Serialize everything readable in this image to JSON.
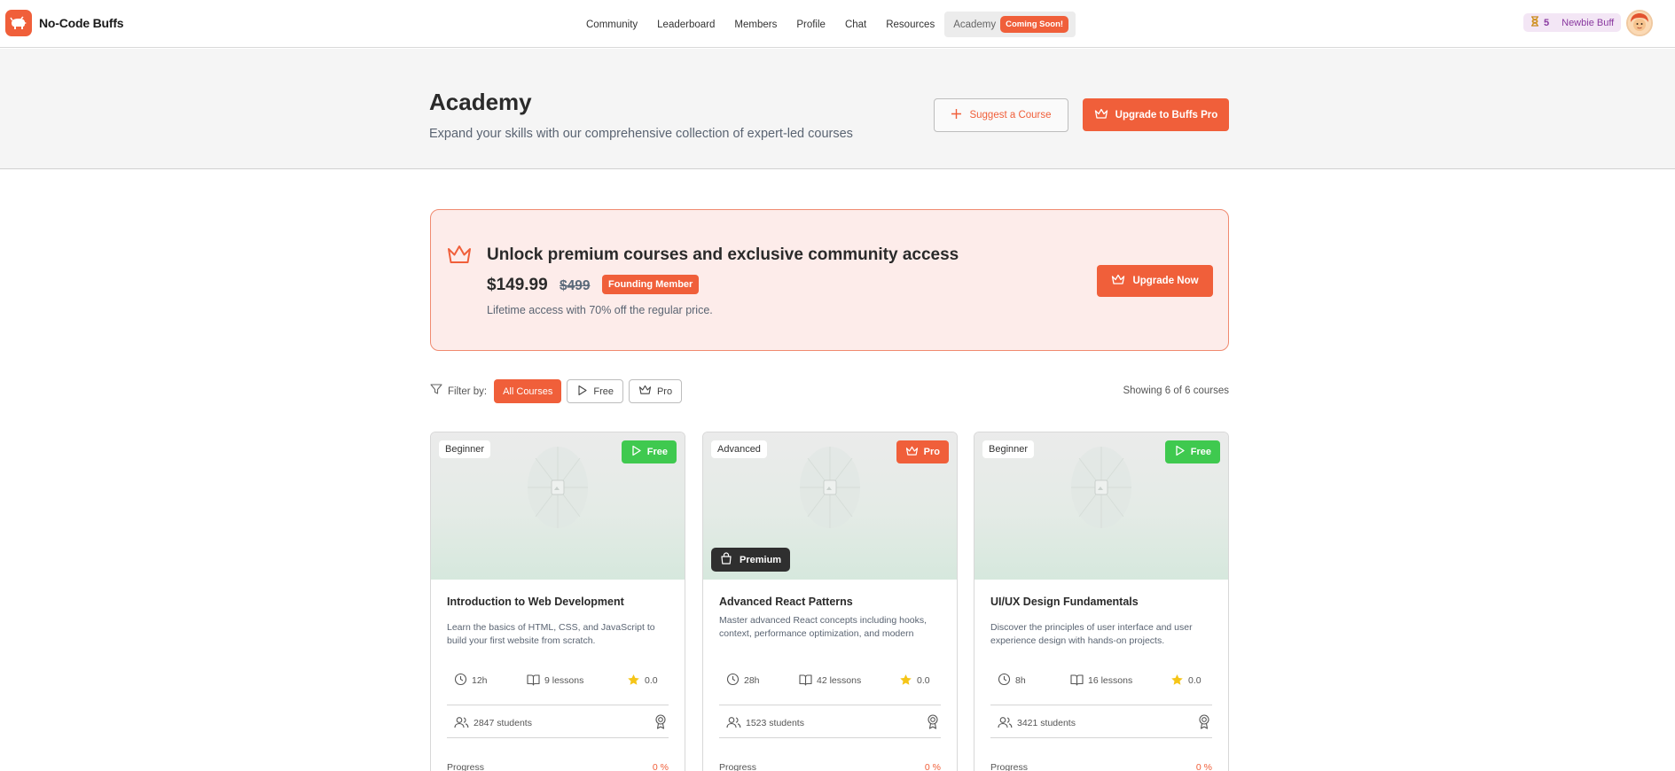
{
  "brand": {
    "name": "No-Code Buffs"
  },
  "nav": {
    "items": [
      "Community",
      "Leaderboard",
      "Members",
      "Profile",
      "Chat",
      "Resources"
    ],
    "active": {
      "label": "Academy",
      "badge": "Coming Soon!"
    }
  },
  "user": {
    "level": "5",
    "rank": "Newbie Buff"
  },
  "header": {
    "title": "Academy",
    "subtitle": "Expand your skills with our comprehensive collection of expert-led courses",
    "suggest_label": "Suggest a Course",
    "upgrade_label": "Upgrade to Buffs Pro"
  },
  "promo": {
    "title": "Unlock premium courses and exclusive community access",
    "price": "$149.99",
    "old_price": "$499",
    "badge": "Founding Member",
    "note": "Lifetime access with 70% off the regular price.",
    "button": "Upgrade Now"
  },
  "filters": {
    "label": "Filter by:",
    "options": [
      "All Courses",
      "Free",
      "Pro"
    ],
    "showing": "Showing 6 of 6 courses"
  },
  "progress_label": "Progress",
  "courses": [
    {
      "level": "Beginner",
      "tier": "Free",
      "premium": "",
      "title": "Introduction to Web Development",
      "description": "Learn the basics of HTML, CSS, and JavaScript to build your first website from scratch.",
      "duration": "12h",
      "lessons": "9 lessons",
      "rating": "0.0",
      "students": "2847 students",
      "progress": "0 %"
    },
    {
      "level": "Advanced",
      "tier": "Pro",
      "premium": "Premium",
      "title": "Advanced React Patterns",
      "description": "Master advanced React concepts including hooks, context, performance optimization, and modern",
      "duration": "28h",
      "lessons": "42 lessons",
      "rating": "0.0",
      "students": "1523 students",
      "progress": "0 %"
    },
    {
      "level": "Beginner",
      "tier": "Free",
      "premium": "",
      "title": "UI/UX Design Fundamentals",
      "description": "Discover the principles of user interface and user experience design with hands-on projects.",
      "duration": "8h",
      "lessons": "16 lessons",
      "rating": "0.0",
      "students": "3421 students",
      "progress": "0 %"
    }
  ],
  "colors": {
    "accent": "#f05f3a",
    "free": "#3fc94f",
    "premium_tag": "#2f2f2f",
    "star": "#f5c518"
  }
}
